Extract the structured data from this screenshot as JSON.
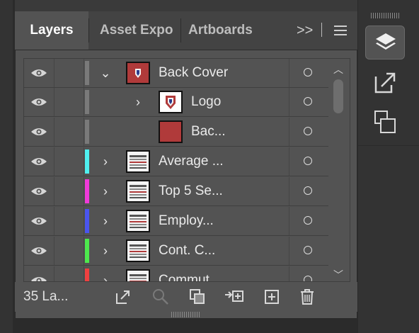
{
  "panel": {
    "tabs": [
      {
        "label": "Layers",
        "active": true
      },
      {
        "label": "Asset Expo",
        "active": false
      },
      {
        "label": "Artboards",
        "active": false
      }
    ],
    "overflow_label": ">>",
    "menu_icon": "hamburger-menu-icon"
  },
  "layers": [
    {
      "name": "Back Cover",
      "expanded": true,
      "indent": 0,
      "color": "#7a7a7a",
      "thumb": "back-cover-thumb"
    },
    {
      "name": "Logo",
      "expanded": false,
      "indent": 1,
      "color": "#7a7a7a",
      "thumb": "logo-thumb"
    },
    {
      "name": "Bac...",
      "expanded": null,
      "indent": 2,
      "color": "#7a7a7a",
      "thumb": "red-rect-thumb"
    },
    {
      "name": "Average ...",
      "expanded": false,
      "indent": 0,
      "color": "#4ff0f0",
      "thumb": "table-thumb"
    },
    {
      "name": "Top 5 Se...",
      "expanded": false,
      "indent": 0,
      "color": "#f03ad9",
      "thumb": "table-thumb"
    },
    {
      "name": "Employ...",
      "expanded": false,
      "indent": 0,
      "color": "#4a55f0",
      "thumb": "table-thumb"
    },
    {
      "name": "Cont. C...",
      "expanded": false,
      "indent": 0,
      "color": "#4de84d",
      "thumb": "table-thumb"
    },
    {
      "name": "Commut...",
      "expanded": false,
      "indent": 0,
      "color": "#f04040",
      "thumb": "table-thumb"
    }
  ],
  "footer": {
    "count": "35 La...",
    "icons": [
      "export-icon",
      "search-icon",
      "clipping-mask-icon",
      "move-to-layer-icon",
      "new-sublayer-icon",
      "trash-icon"
    ]
  },
  "dock": {
    "icons": [
      "layers-icon",
      "export-panel-icon",
      "artboards-icon"
    ]
  }
}
